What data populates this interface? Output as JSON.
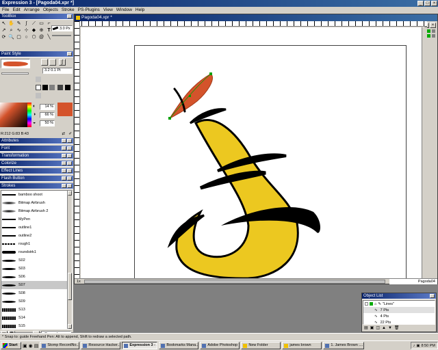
{
  "window": {
    "title": "Expression 3 - [Pagoda04.xpr *]"
  },
  "menu": [
    "File",
    "Edit",
    "Arrange",
    "Objects",
    "Stroke",
    "PS-Plugins",
    "View",
    "Window",
    "Help"
  ],
  "toolbox": {
    "title": "ToolBox",
    "size_value": "3.0",
    "size_unit": "Px"
  },
  "paint_style": {
    "title": "Paint Style",
    "width_value": "3.2",
    "width_value2": "0.1",
    "width_unit": "Pt"
  },
  "color": {
    "h": "14",
    "s": "66",
    "l": "50",
    "unit": "%",
    "rgb": "R:212 G:83 B:43",
    "swatch": "#d4532b"
  },
  "panels": [
    "Attributes",
    "Font",
    "Transformation",
    "Colorize",
    "Effect Lines",
    "Flash Button",
    "Strokes"
  ],
  "strokes": [
    {
      "name": "bamboo shoot",
      "icon": "bamboo-stroke-icon"
    },
    {
      "name": "Bitmap Airbrush",
      "icon": "airbrush-stroke-icon"
    },
    {
      "name": "Bitmap Airbrush 2",
      "icon": "airbrush-stroke-icon"
    },
    {
      "name": "MyPen",
      "icon": "pen-stroke-icon"
    },
    {
      "name": "outline1",
      "icon": "line-stroke-icon"
    },
    {
      "name": "outline2",
      "icon": "line-stroke-icon"
    },
    {
      "name": "rough1",
      "icon": "rough-stroke-icon"
    },
    {
      "name": "roundstrk1",
      "icon": "round-stroke-icon"
    },
    {
      "name": "S02",
      "icon": "taper-stroke-icon"
    },
    {
      "name": "S03",
      "icon": "taper-stroke-icon"
    },
    {
      "name": "S06",
      "icon": "taper-stroke-icon"
    },
    {
      "name": "S07",
      "icon": "taper-stroke-icon"
    },
    {
      "name": "S08",
      "icon": "taper-stroke-icon"
    },
    {
      "name": "S09",
      "icon": "taper-stroke-icon"
    },
    {
      "name": "S13",
      "icon": "texture-stroke-icon"
    },
    {
      "name": "S14",
      "icon": "texture-stroke-icon"
    },
    {
      "name": "S15",
      "icon": "texture-stroke-icon"
    }
  ],
  "strokes_selected": "S07",
  "strokes_category": "rGenerab",
  "document": {
    "title": "Pagoda04.xpr *",
    "zoom": "1x",
    "page_label": "Pagoda04"
  },
  "object_list": {
    "title": "Object List",
    "items": [
      {
        "label": "\"Lines\""
      },
      {
        "label": "7 Pts"
      },
      {
        "label": "4 Pts"
      },
      {
        "label": "22 Pts"
      }
    ]
  },
  "status": {
    "text": "* Snap to: guide    Freehand Pen: Alt to append, Shift to redraw a selected path."
  },
  "taskbar": {
    "start": "Start",
    "items": [
      "Stomp RecordNo...",
      "Resource Hacker...",
      "Expression 3 - ...",
      "Bookmarks Mana...",
      "Adobe Photoshop",
      "New Folder",
      "james brown",
      "1. James Brown ...."
    ],
    "clock": "8:50 PM"
  },
  "colors": {
    "accent": "#0a246a",
    "face": "#d4d0c8",
    "yellow": "#ecc820",
    "orange": "#d4532b"
  }
}
